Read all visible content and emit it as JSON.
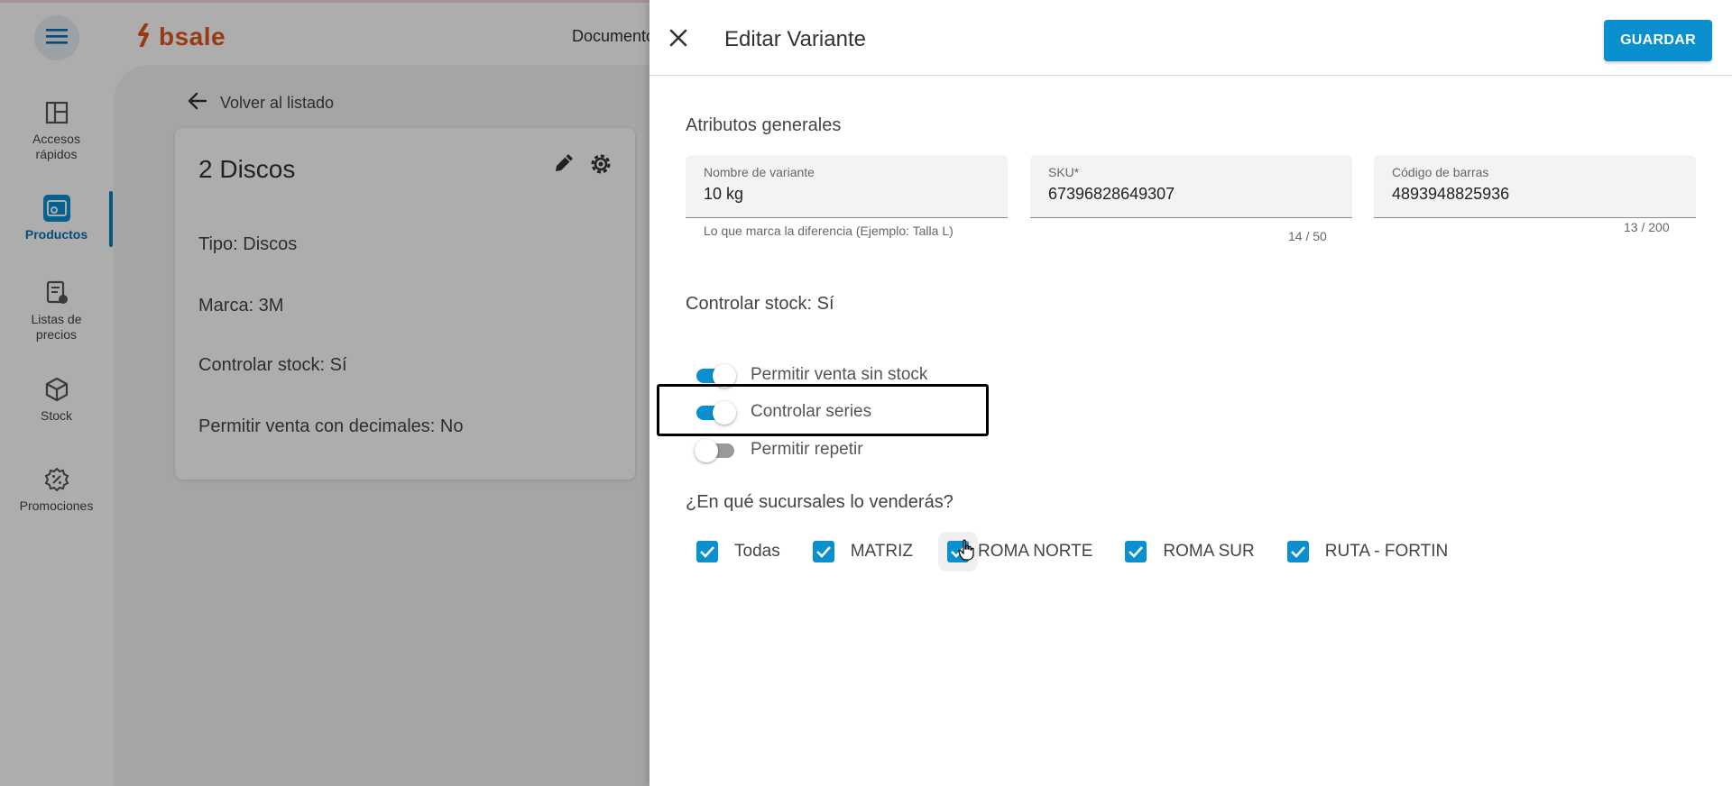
{
  "app": {
    "brand": "bsale",
    "top_nav_text": "Documento"
  },
  "sidebar": {
    "items": [
      {
        "label": "Accesos rápidos",
        "icon": "dashboard-icon"
      },
      {
        "label": "Productos",
        "icon": "products-icon",
        "active": true
      },
      {
        "label": "Listas de precios",
        "icon": "price-list-icon"
      },
      {
        "label": "Stock",
        "icon": "box-icon"
      },
      {
        "label": "Promociones",
        "icon": "promotion-icon"
      }
    ]
  },
  "page": {
    "back_label": "Volver al listado",
    "product": {
      "title": "2 Discos",
      "tipo": "Tipo: Discos",
      "marca": "Marca: 3M",
      "controlar_stock": "Controlar stock: Sí",
      "venta_decimales": "Permitir venta con decimales: No"
    }
  },
  "drawer": {
    "title": "Editar Variante",
    "save_label": "GUARDAR",
    "general_title": "Atributos generales",
    "fields": {
      "nombre": {
        "label": "Nombre de variante",
        "value": "10 kg",
        "helper": "Lo que marca la diferencia (Ejemplo: Talla L)",
        "counter": "14 / 50"
      },
      "sku": {
        "label": "SKU*",
        "value": "67396828649307"
      },
      "barcode": {
        "label": "Código de barras",
        "value": "4893948825936",
        "counter": "13 / 200"
      }
    },
    "stock_title": "Controlar stock: Sí",
    "toggles": [
      {
        "label": "Permitir venta sin stock",
        "on": true
      },
      {
        "label": "Controlar series",
        "on": true
      },
      {
        "label": "Permitir repetir",
        "on": false
      }
    ],
    "branches_title": "¿En qué sucursales lo venderás?",
    "branches": [
      {
        "label": "Todas",
        "checked": true
      },
      {
        "label": "MATRIZ",
        "checked": true
      },
      {
        "label": "ROMA NORTE",
        "checked": true
      },
      {
        "label": "ROMA SUR",
        "checked": true
      },
      {
        "label": "RUTA - FORTIN",
        "checked": true
      }
    ]
  },
  "colors": {
    "accent": "#0a8fcf",
    "brand": "#e2561f"
  }
}
